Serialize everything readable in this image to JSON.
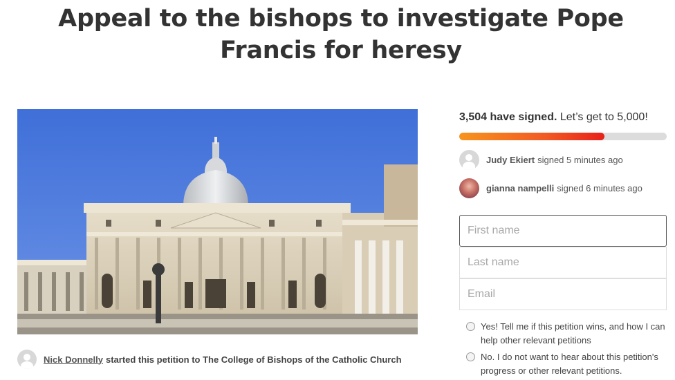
{
  "title": "Appeal to the bishops to investigate Pope Francis for heresy",
  "starter": {
    "name": "Nick Donnelly",
    "text": "started this petition to The College of Bishops of the Catholic Church"
  },
  "signatures": {
    "count_text": "3,504 have signed.",
    "goal_text": "Let’s get to 5,000!",
    "progress_fraction": 0.7008,
    "progress_color": "#f15a24"
  },
  "recent_signers": [
    {
      "name": "Judy Ekiert",
      "action": "signed 5 minutes ago",
      "avatar": "default-avatar-icon"
    },
    {
      "name": "gianna nampelli",
      "action": "signed 6 minutes ago",
      "avatar": "user-photo"
    }
  ],
  "form": {
    "first_name_placeholder": "First name",
    "last_name_placeholder": "Last name",
    "email_placeholder": "Email",
    "option_yes": "Yes! Tell me if this petition wins, and how I can help other relevant petitions",
    "option_no": "No. I do not want to hear about this petition's progress or other relevant petitions."
  }
}
